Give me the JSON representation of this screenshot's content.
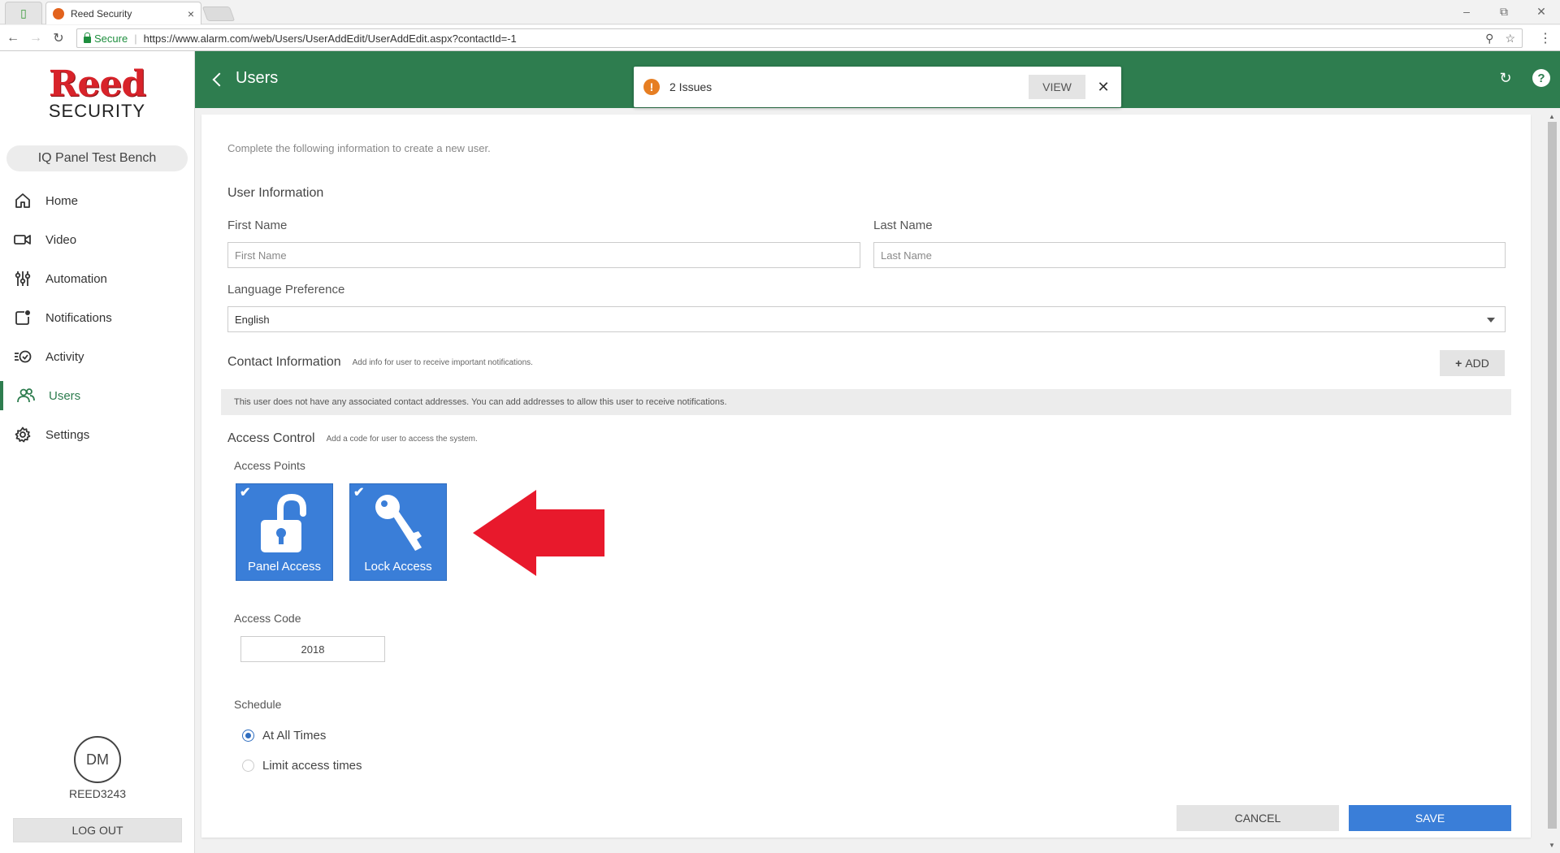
{
  "browser": {
    "tab_title": "Reed Security",
    "tab_close": "×",
    "secure_label": "Secure",
    "url": "https://www.alarm.com/web/Users/UserAddEdit/UserAddEdit.aspx?contactId=-1"
  },
  "sidebar": {
    "logo_main": "Reed",
    "logo_sub": "SECURITY",
    "panel_name": "IQ Panel Test Bench",
    "items": [
      {
        "label": "Home"
      },
      {
        "label": "Video"
      },
      {
        "label": "Automation"
      },
      {
        "label": "Notifications"
      },
      {
        "label": "Activity"
      },
      {
        "label": "Users",
        "active": true
      },
      {
        "label": "Settings"
      }
    ],
    "avatar_initials": "DM",
    "username": "REED3243",
    "logout_label": "LOG OUT"
  },
  "header": {
    "title": "Users"
  },
  "issues": {
    "text": "2 Issues",
    "view_label": "VIEW"
  },
  "form": {
    "intro": "Complete the following information to create a new user.",
    "user_info_title": "User Information",
    "first_name_label": "First Name",
    "first_name_placeholder": "First Name",
    "last_name_label": "Last Name",
    "last_name_placeholder": "Last Name",
    "language_label": "Language Preference",
    "language_value": "English",
    "contact_title": "Contact Information",
    "contact_hint": "Add info for user to receive important notifications.",
    "add_label": "ADD",
    "contact_note": "This user does not have any associated contact addresses. You can add addresses to allow this user to receive notifications.",
    "access_title": "Access Control",
    "access_hint": "Add a code for user to access the system.",
    "access_points_label": "Access Points",
    "tiles": [
      {
        "label": "Panel Access",
        "checked": true
      },
      {
        "label": "Lock Access",
        "checked": true
      }
    ],
    "access_code_label": "Access Code",
    "access_code_value": "2018",
    "schedule_label": "Schedule",
    "schedule_options": [
      {
        "label": "At All Times",
        "selected": true
      },
      {
        "label": "Limit access times",
        "selected": false
      }
    ],
    "cancel_label": "CANCEL",
    "save_label": "SAVE"
  },
  "colors": {
    "brand_green": "#2e7d4f",
    "primary_blue": "#3a7ed8",
    "annotation_red": "#e8192c",
    "logo_red": "#d8232a",
    "warning_orange": "#e67e22"
  }
}
